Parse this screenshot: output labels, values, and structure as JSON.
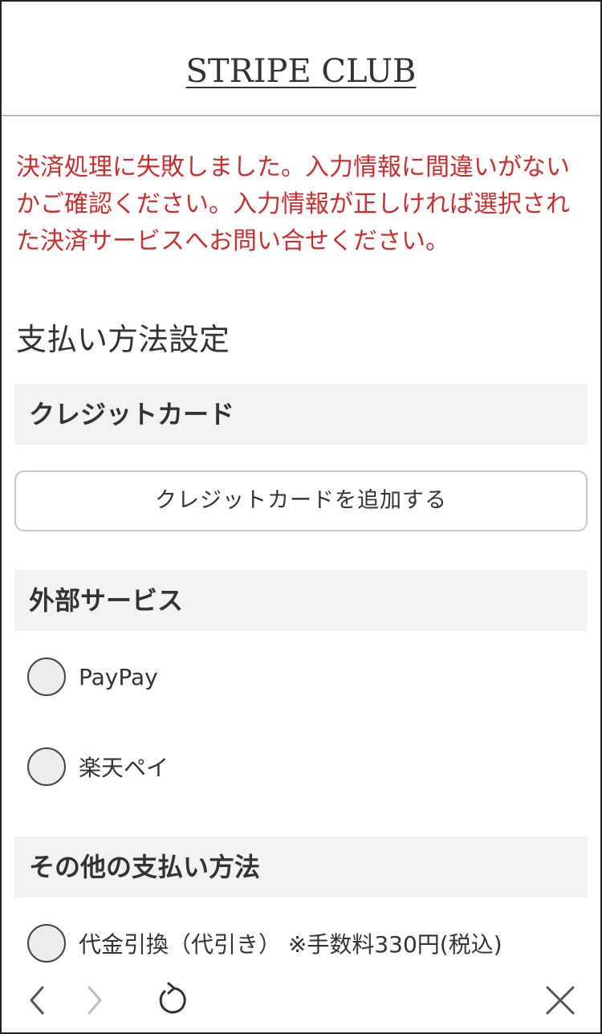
{
  "header": {
    "brand": "STRIPE CLUB"
  },
  "error_message": "決済処理に失敗しました。入力情報に間違いがないかご確認ください。入力情報が正しければ選択された決済サービスへお問い合せください。",
  "page_title": "支払い方法設定",
  "credit_card": {
    "heading": "クレジットカード",
    "add_button": "クレジットカードを追加する"
  },
  "external_services": {
    "heading": "外部サービス",
    "options": [
      {
        "label": "PayPay"
      },
      {
        "label": "楽天ペイ"
      }
    ]
  },
  "other_methods": {
    "heading": "その他の支払い方法",
    "options": [
      {
        "label": "代金引換（代引き） ※手数料330円(税込)"
      }
    ]
  },
  "browser_nav": {
    "icons": [
      "back-icon",
      "forward-icon",
      "reload-icon",
      "close-icon"
    ],
    "forward_enabled": false
  },
  "colors": {
    "error": "#c8302f",
    "section_bg": "#f3f3f3",
    "text": "#333333"
  }
}
